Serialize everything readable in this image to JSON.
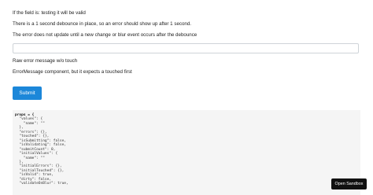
{
  "info": {
    "line1": "If the field is: testing it will be valid",
    "line2": "There is a 1 second debounce in place, so an error should show up after 1 second.",
    "line3": "The error does not update until a new change or blur event occurs after the debounce",
    "raw_error_label": "Raw error message w/o touch",
    "error_component_label": "ErrorMessage component, but it expects a touched first"
  },
  "form": {
    "field_value": "",
    "submit_label": "Submit"
  },
  "props_dump": {
    "lines": [
      "props = {",
      "  \"values\": {",
      "    \"name\": \"\"",
      "  },",
      "  \"errors\": {},",
      "  \"touched\": {},",
      "  \"isSubmitting\": false,",
      "  \"isValidating\": false,",
      "  \"submitCount\": 0,",
      "  \"initialValues\": {",
      "    \"name\": \"\"",
      "  },",
      "  \"initialErrors\": {},",
      "  \"initialTouched\": {},",
      "  \"isValid\": true,",
      "  \"dirty\": false,",
      "  \"validateOnBlur\": true,"
    ]
  },
  "sandbox": {
    "open_label": "Open Sandbox"
  }
}
